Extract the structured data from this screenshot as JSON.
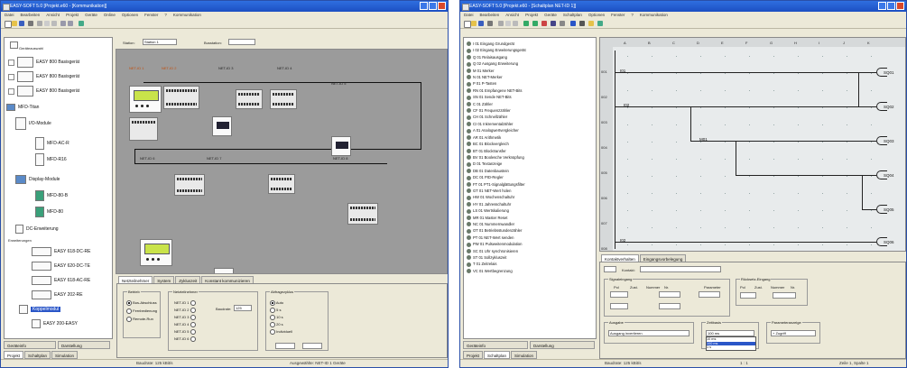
{
  "windows": [
    {
      "title": "EASY-SOFT 5.0 [Projekt.e60 - [Kommunikation]]",
      "menu": [
        "Datei",
        "Bearbeiten",
        "Ansicht",
        "Projekt",
        "Geräte",
        "Online",
        "Optionen",
        "Fenster",
        "?",
        "Kommunikation"
      ],
      "top_select": "Station 1",
      "top_select_label": "Station:",
      "top_select2_label": "Busstation:",
      "tree_group_labels": [
        "Geräteauswahl",
        "Erweiterungen"
      ],
      "tree_items": [
        "EASY 800 Basisgerät",
        "EASY 800 Basisgerät",
        "EASY 800 Basisgerät",
        "MFD-Titan",
        "I/O-Module",
        "MFD-AC-R",
        "MFD-R16",
        "Display-Module",
        "MFD-80-B",
        "MFD-80",
        "DC-Erweiterung",
        "EASY 618-DC-RE",
        "EASY 620-DC-TE",
        "EASY 618-AC-RE",
        "EASY 202-RE",
        "Koppelmodul",
        "EASY 200-EASY"
      ],
      "tree_tabs": [
        "Projekt",
        "Schaltplan",
        "Simulation"
      ],
      "tree_bottom_buttons": [
        "Geräteinfo",
        "Darstellung"
      ],
      "net_labels": [
        "NET-ID 1",
        "NET-ID 2",
        "NET-ID 3",
        "NET-ID 4",
        "NET-ID 5",
        "NET-ID 6",
        "NET-ID 7",
        "NET-ID 8"
      ],
      "prop_tabs": [
        "Netzteilnehmer",
        "System",
        "Zykluszeit",
        "Konstant kommunizieren"
      ],
      "prop_group1_title": "Betrieb",
      "prop_group1_options": [
        "Bus-Abschluss",
        "Fernbedienung",
        "Remote-Run"
      ],
      "prop_group2_title": "Netzteilnehmer",
      "prop_group2_rows": [
        "NET-ID 1",
        "NET-ID 2",
        "NET-ID 3",
        "NET-ID 4",
        "NET-ID 5",
        "NET-ID 6"
      ],
      "prop_group2_field": "Baudrate:",
      "prop_group2_value": "125",
      "prop_group3_title": "Abfragezyklus",
      "prop_group3_options": [
        "Auto",
        "5 s",
        "10 s",
        "20 s",
        "Individuell"
      ],
      "status": [
        "Baudrate: 125 kBit/s",
        "Ausgewählte: NET-ID 1 Geräte"
      ]
    },
    {
      "title": "EASY-SOFT 5.0 [Projekt.e60 - [Schaltplan NET-ID 1]]",
      "menu": [
        "Datei",
        "Bearbeiten",
        "Ansicht",
        "Projekt",
        "Geräte",
        "Schaltplan",
        "Optionen",
        "Fenster",
        "?",
        "Kommunikation"
      ],
      "list_items": [
        "I 01 Eingang Grundgerät",
        "I 02 Eingang Erweiterungsgerät",
        "Q 01 Relaisausgang",
        "Q 02 Ausgang Erweiterung",
        "M 01 Merker",
        "N 01 NET-Merker",
        "P 01 P-Tasten",
        "RN 01 Empfangene NET-Bits",
        "SN 01 Sende NET-Bits",
        "C 01 Zähler",
        "CF 01 Frequenzzähler",
        "CH 01 Schnellzähler",
        "CI 01 Inkrementalzähler",
        "A 01 Analogwertvergleicher",
        "AR 01 Arithmetik",
        "BC 01 Blockvergleich",
        "BT 01 Blocktransfer",
        "BV 01 Boolesche Verknüpfung",
        "D 01 Textanzeige",
        "DB 01 Datenbaustein",
        "DC 01 PID-Regler",
        "FT 01 PT1-Signalglättungsfilter",
        "GT 01 NET-Wert holen",
        "HW 01 Wochenschaltuhr",
        "HY 01 Jahresschaltuhr",
        "LS 01 Wertskalierung",
        "MR 01 Master Reset",
        "NC 01 Nummernwandler",
        "OT 01 Betriebsstundenzähler",
        "PT 01 NET-Wert senden",
        "PW 01 Pulsweitenmodulation",
        "SC 01 Uhr synchronisieren",
        "ST 01 Sollzykluszeit",
        "T 01 Zeitrelais",
        "VC 01 Wertbegrenzung"
      ],
      "list_tabs": [
        "Projekt",
        "Schaltplan",
        "Simulation"
      ],
      "list_bottom_buttons": [
        "Geräteinfo",
        "Darstellung"
      ],
      "ladder_col_labels": [
        "A",
        "B",
        "C",
        "D",
        "E",
        "F",
        "G",
        "H",
        "I",
        "J",
        "K"
      ],
      "ladder_row_labels": [
        "001",
        "002",
        "003",
        "004",
        "005",
        "006",
        "007",
        "008"
      ],
      "ladder_contacts": [
        "I01",
        "I02",
        "M01"
      ],
      "ladder_coils": [
        "SQ01",
        "SQ02",
        "SQ03",
        "SQ04",
        "SQ05",
        "SQ06"
      ],
      "prop_tabs": [
        "Kontaktverhalten",
        "Eingangsvorbelegung"
      ],
      "prop_select_label": "Kontakt:",
      "prop_group1_title": "Signaleingang",
      "prop_group1_headers": [
        "Pol",
        "Zust.",
        "Nummer",
        "Nr.",
        "Parameter"
      ],
      "prop_group2_title": "Ausgabe",
      "prop_group3_title": "Zeitbasis",
      "prop_group3_select": "100 ms",
      "prop_group3_options": [
        "10 ms",
        "100 ms",
        "1 s"
      ],
      "prop_group4_title": "Parameteranzeige",
      "prop_group4_select": "+ Zugriff",
      "prop_group5_title": "Rücksetz-Eingang",
      "prop_group5_headers": [
        "Pol",
        "Zust.",
        "Nummer",
        "Nr."
      ],
      "prop_group2_select": "Ausgang invertieren",
      "status": [
        "Baudrate: 125 kBit/s",
        "1 : 1",
        "Zeile 1, Spalte 1"
      ]
    }
  ]
}
